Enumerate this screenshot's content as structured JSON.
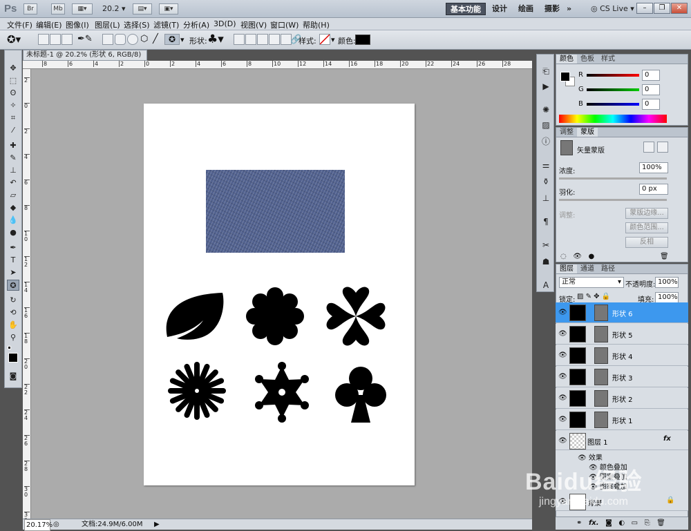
{
  "app": {
    "logo": "Ps",
    "zoom_display": "20.2"
  },
  "workspace": {
    "active": "基本功能",
    "items": [
      "设计",
      "绘画",
      "摄影"
    ],
    "more": "»",
    "cslive": "CS Live"
  },
  "menus": [
    "文件(F)",
    "编辑(E)",
    "图像(I)",
    "图层(L)",
    "选择(S)",
    "滤镜(T)",
    "分析(A)",
    "3D(D)",
    "视图(V)",
    "窗口(W)",
    "帮助(H)"
  ],
  "options": {
    "shape_label": "形状:",
    "style_label": "样式:",
    "color_label": "颜色:",
    "shape_glyph": "♣",
    "color": "#000000"
  },
  "document": {
    "tab_title": "未标题-1 @ 20.2% (形状 6, RGB/8) *",
    "zoom": "20.17%",
    "file_info": "文档:24.9M/6.00M"
  },
  "ruler": {
    "top": [
      "8",
      "6",
      "4",
      "2",
      "0",
      "2",
      "4",
      "6",
      "8",
      "10",
      "12",
      "14",
      "16",
      "18",
      "20",
      "22",
      "24",
      "26",
      "28"
    ],
    "left": [
      "2",
      "0",
      "2",
      "4",
      "6",
      "8",
      "1 0",
      "1 2",
      "1 4",
      "1 6",
      "1 8",
      "2 0",
      "2 2",
      "2 4",
      "2 6",
      "2 8",
      "3 0",
      "3 2"
    ]
  },
  "color_panel": {
    "tabs": [
      "颜色",
      "色板",
      "样式"
    ],
    "r": "0",
    "g": "0",
    "b": "0",
    "r_label": "R",
    "g_label": "G",
    "b_label": "B"
  },
  "mask_panel": {
    "tabs": [
      "调整",
      "蒙版"
    ],
    "title": "矢量蒙版",
    "density_label": "浓度:",
    "density_value": "100%",
    "feather_label": "羽化:",
    "feather_value": "0 px",
    "refine_label": "调整:",
    "btn_edge": "蒙版边缘...",
    "btn_range": "颜色范围...",
    "btn_invert": "反相"
  },
  "layers_panel": {
    "tabs": [
      "图层",
      "通道",
      "路径"
    ],
    "blend_mode": "正常",
    "opacity_label": "不透明度:",
    "opacity_value": "100%",
    "lock_label": "锁定:",
    "fill_label": "填充:",
    "fill_value": "100%",
    "layers": [
      {
        "name": "形状 6",
        "selected": true
      },
      {
        "name": "形状 5",
        "selected": false
      },
      {
        "name": "形状 4",
        "selected": false
      },
      {
        "name": "形状 3",
        "selected": false
      },
      {
        "name": "形状 2",
        "selected": false
      },
      {
        "name": "形状 1",
        "selected": false
      }
    ],
    "layer1_name": "图层 1",
    "effects_label": "效果",
    "effects": [
      "颜色叠加",
      "图案叠加",
      "图案叠加"
    ],
    "bg_name": "背景",
    "fx": "fx"
  },
  "watermark": {
    "text": "Baidu经验",
    "sub": "jingyan.baidu.com"
  }
}
